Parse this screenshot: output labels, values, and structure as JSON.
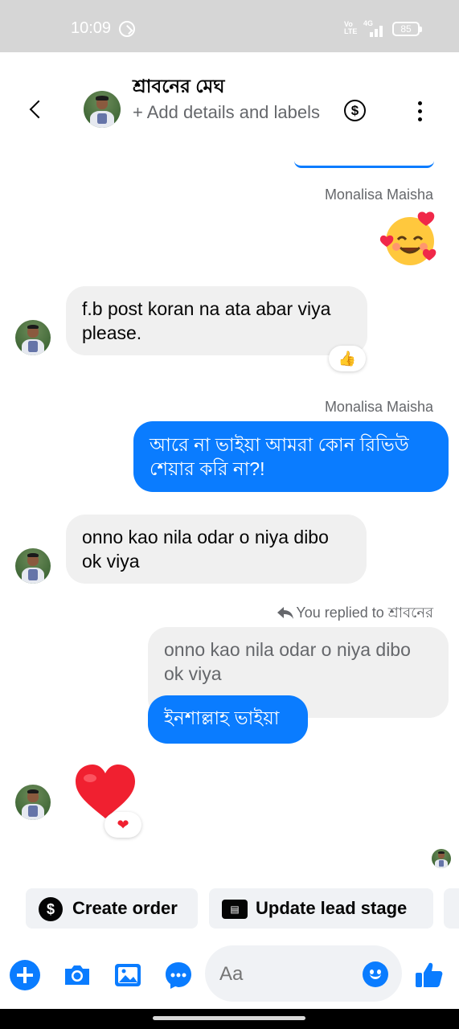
{
  "status_bar": {
    "time": "10:09",
    "network_volte": "Vo LTE",
    "network_type": "4G",
    "battery": "85"
  },
  "header": {
    "contact_name": "শ্রাবনের মেঘ",
    "subtitle": "+ Add details and labels",
    "icons": [
      "back-icon",
      "dollar-icon",
      "more-icon"
    ]
  },
  "messages": [
    {
      "sender": "Monalisa Maisha",
      "type": "emoji",
      "content": "🥰"
    },
    {
      "direction": "in",
      "text": "f.b post koran na ata abar viya please.",
      "reaction": "👍"
    },
    {
      "sender": "Monalisa Maisha",
      "direction": "out",
      "text": "আরে না ভাইয়া আমরা কোন রিভিউ শেয়ার করি না?!"
    },
    {
      "direction": "in",
      "text": "onno kao nila odar o niya dibo ok viya"
    },
    {
      "reply_label": "You replied to শ্রাবনের",
      "quoted_text": "onno kao nila odar o niya dibo ok viya",
      "direction": "out",
      "text": "ইনশাল্লাহ ভাইয়া"
    },
    {
      "direction": "in",
      "type": "emoji",
      "content": "❤",
      "reaction": "❤"
    }
  ],
  "quick_actions": [
    {
      "label": "Create order",
      "icon": "dollar-circle-icon"
    },
    {
      "label": "Update lead stage",
      "icon": "id-card-icon"
    }
  ],
  "composer": {
    "placeholder": "Aa",
    "icons": [
      "plus-icon",
      "camera-icon",
      "gallery-icon",
      "chat-bubble-icon",
      "emoji-icon",
      "like-icon"
    ]
  },
  "colors": {
    "accent": "#0a7cff",
    "incoming_bubble": "#f0f0f0",
    "secondary_text": "#65676b"
  }
}
